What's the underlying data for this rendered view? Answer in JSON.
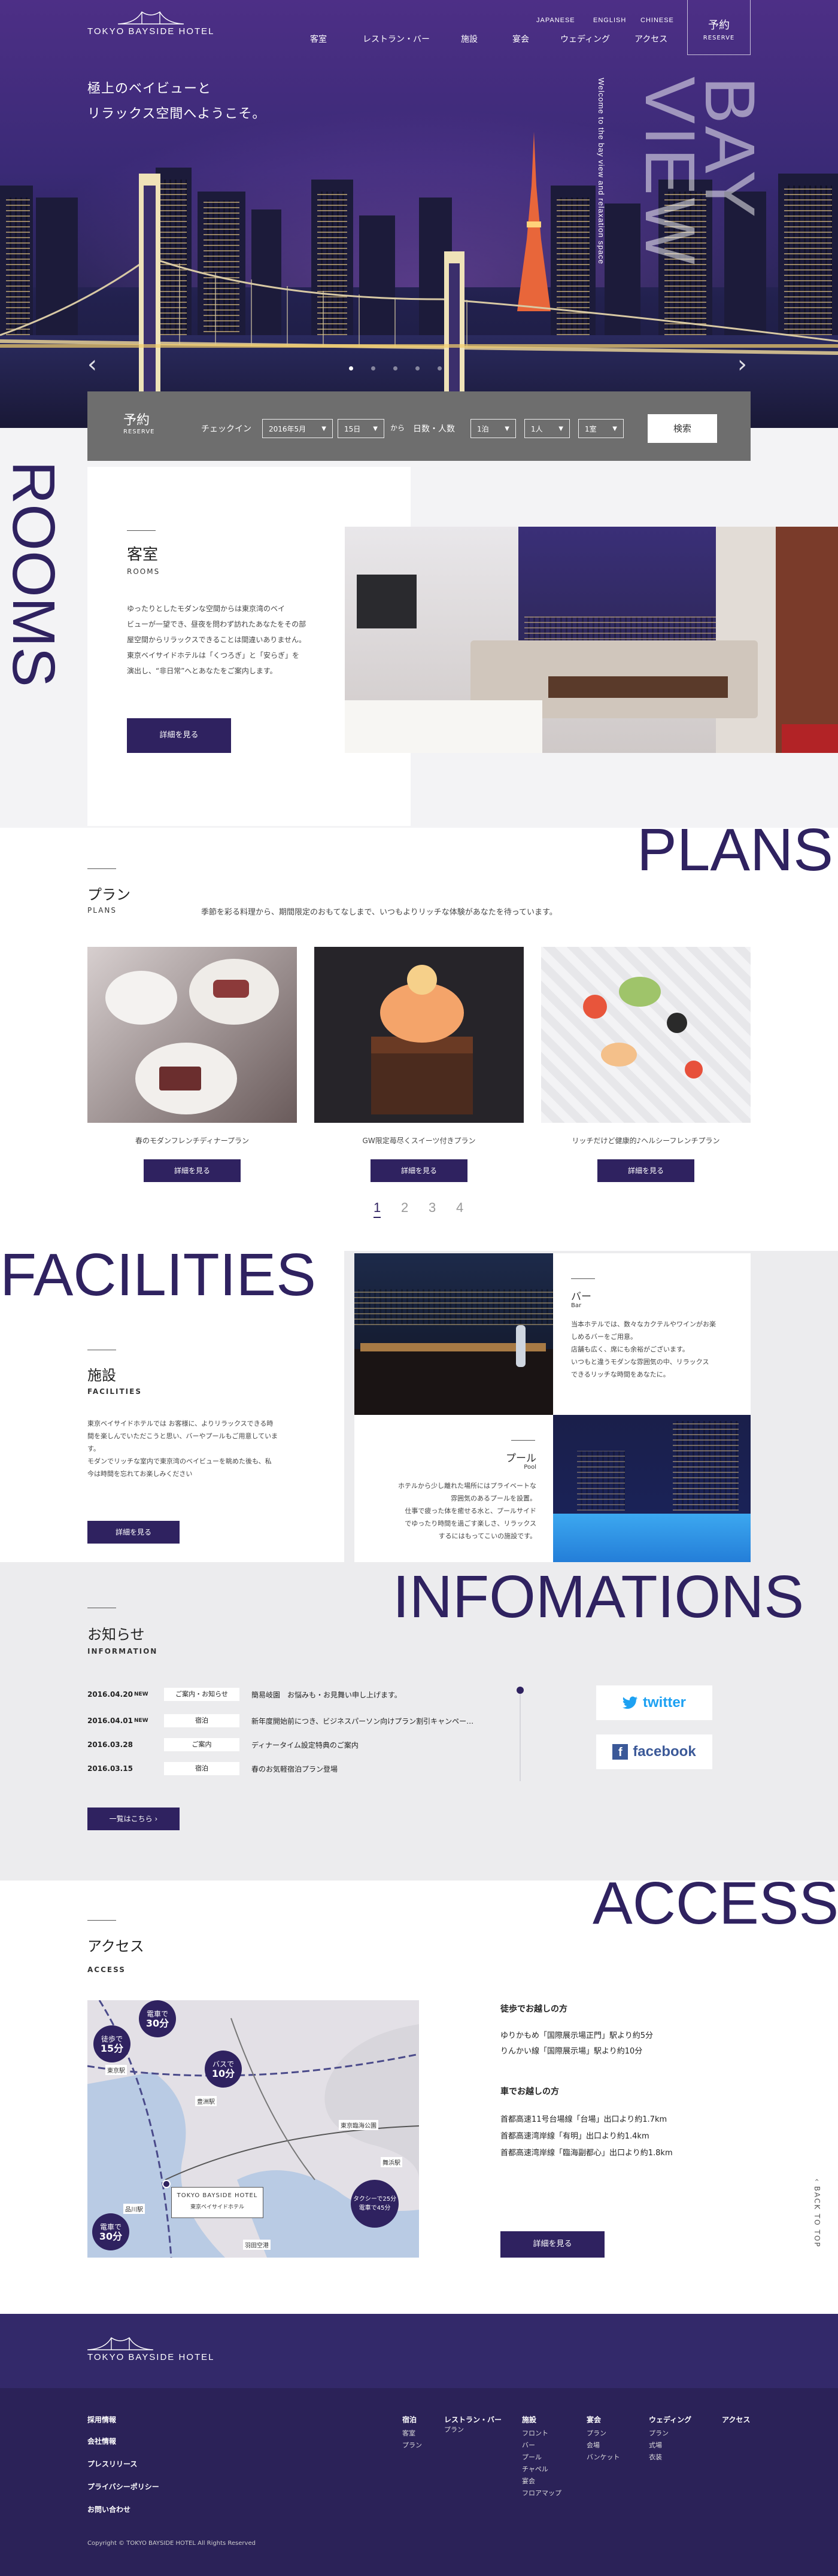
{
  "header": {
    "logo": "TOKYO BAYSIDE HOTEL",
    "langs": [
      "JAPANESE",
      "ENGLISH",
      "CHINESE"
    ],
    "nav": [
      "客室",
      "レストラン・バー",
      "施設",
      "宴会",
      "ウェディング",
      "アクセス"
    ],
    "reserve_ja": "予約",
    "reserve_en": "RESERVE"
  },
  "hero": {
    "copy_line1": "極上のベイビューと",
    "copy_line2": "リラックス空間へようこそ。",
    "big_word1": "BAY",
    "big_word2": "VIEW",
    "welcome_line1": "Welcome to",
    "welcome_line2": "the bay view and",
    "welcome_line3": "relaxation space"
  },
  "reserve_bar": {
    "title_ja": "予約",
    "title_en": "RESERVE",
    "checkin_label": "チェックイン",
    "month_value": "2016年5月",
    "day_value": "15日",
    "from_label": "から",
    "guests_label": "日数・人数",
    "nights_value": "1泊",
    "people_value": "1人",
    "rooms_value": "1室",
    "search_label": "検索"
  },
  "rooms": {
    "big": "ROOMS",
    "title_ja": "客室",
    "title_en": "ROOMS",
    "body1": "ゆったりとしたモダンな空間からは東京湾のベイ",
    "body2": "ビューが一望でき、昼夜を問わず訪れたあなたをその部",
    "body3": "屋空間からリラックスできることは間違いありません。",
    "body4": "東京ベイサイドホテルは「くつろぎ」と「安らぎ」を",
    "body5": "演出し、“非日常”へとあなたをご案内します。",
    "button": "詳細を見る"
  },
  "plans": {
    "big": "PLANS",
    "title_ja": "プラン",
    "title_en": "PLANS",
    "lead": "季節を彩る料理から、期間限定のおもてなしまで、いつもよりリッチな体験があなたを待っています。",
    "items": [
      {
        "caption": "春のモダンフレンチディナープラン",
        "button": "詳細を見る"
      },
      {
        "caption": "GW限定苺尽くスイーツ付きプラン",
        "button": "詳細を見る"
      },
      {
        "caption": "リッチだけど健康的♪ヘルシーフレンチプラン",
        "button": "詳細を見る"
      }
    ],
    "pages": [
      "1",
      "2",
      "3",
      "4"
    ]
  },
  "facilities": {
    "big": "FACILITIES",
    "title_ja": "施設",
    "title_en": "FACILITIES",
    "body1": "東京ベイサイドホテルでは お客様に、よりリラックスできる時",
    "body2": "間を楽しんでいただこうと思い、バーやプールもご用意していま",
    "body3": "す。",
    "body4": "モダンでリッチな室内で東京湾のベイビューを眺めた後も、私",
    "body5": "今は時間を忘れてお楽しみください",
    "button": "詳細を見る",
    "bar_ja": "バー",
    "bar_en": "Bar",
    "bar_body1": "当本ホテルでは、数々なカクテルやワインがお楽",
    "bar_body2": "しめるバーをご用意。",
    "bar_body3": "店舗も広く、席にも余裕がございます。",
    "bar_body4": "いつもと違うモダンな雰囲気の中、リラックス",
    "bar_body5": "できるリッチな時間をあなたに。",
    "pool_ja": "プール",
    "pool_en": "Pool",
    "pool_body1": "ホテルから少し離れた場所にはプライベートな",
    "pool_body2": "雰囲気のあるプールを設置。",
    "pool_body3": "仕事で疲った体を癒せる水と、プールサイド",
    "pool_body4": "でゆったり時間を過ごす楽しさ、リラックス",
    "pool_body5": "するにはもってこいの施設です。"
  },
  "info": {
    "big": "INFOMATIONS",
    "title_ja": "お知らせ",
    "title_en": "INFORMATION",
    "news": [
      {
        "date": "2016.04.20",
        "new": "NEW",
        "cat": "ご案内・お知らせ",
        "text": "簡易岐園　お悩みも・お見舞い申し上げます。"
      },
      {
        "date": "2016.04.01",
        "new": "NEW",
        "cat": "宿泊",
        "text": "新年度開始前につき、ビジネスパーソン向けプラン割引キャンペー…"
      },
      {
        "date": "2016.03.28",
        "new": "",
        "cat": "ご案内",
        "text": "ディナータイム設定特典のご案内"
      },
      {
        "date": "2016.03.15",
        "new": "",
        "cat": "宿泊",
        "text": "春のお気軽宿泊プラン登場"
      }
    ],
    "list_button": "一覧はこちら",
    "twitter": "twitter",
    "facebook": "facebook"
  },
  "access": {
    "big": "ACCESS",
    "title_ja": "アクセス",
    "title_en": "ACCESS",
    "walk_title": "徒歩でお越しの方",
    "walk1": "ゆりかもめ「国際展示場正門」駅より約5分",
    "walk2": "りんかい線「国際展示場」駅より約10分",
    "car_title": "車でお越しの方",
    "car1": "首都高速11号台場線「台場」出口より約1.7km",
    "car2": "首都高速湾岸線「有明」出口より約1.4km",
    "car3": "首都高速湾岸線「臨海副都心」出口より約1.8km",
    "button": "詳細を見る",
    "back_to_top": "BACK TO TOP",
    "map_badges": [
      {
        "l1": "電車で",
        "l2": "30分"
      },
      {
        "l1": "徒歩で",
        "l2": "15分"
      },
      {
        "l1": "バスで",
        "l2": "10分"
      },
      {
        "l1": "電車で",
        "l2": "30分"
      },
      {
        "l1": "タクシーで25分",
        "l2": "電車で45分"
      }
    ],
    "map_places": [
      "東京駅",
      "豊洲駅",
      "品川駅",
      "東京臨海公園",
      "舞浜駅",
      "羽田空港"
    ],
    "map_hotel": "TOKYO BAYSIDE HOTEL",
    "map_hotel_sub": "東京ベイサイドホテル"
  },
  "footer": {
    "logo": "TOKYO BAYSIDE HOTEL",
    "left": [
      "採用情報",
      "会社情報",
      "プレスリリース",
      "プライバシーポリシー",
      "お問い合わせ"
    ],
    "cols": [
      {
        "head": "宿泊",
        "subs": [
          "客室",
          "プラン"
        ]
      },
      {
        "head": "レストラン・バー",
        "subs": [
          "プラン"
        ]
      },
      {
        "head": "施設",
        "subs": [
          "フロント",
          "バー",
          "プール",
          "チャペル",
          "宴会",
          "フロアマップ"
        ]
      },
      {
        "head": "宴会",
        "subs": [
          "プラン",
          "会場",
          "バンケット"
        ]
      },
      {
        "head": "ウェディング",
        "subs": [
          "プラン",
          "式場",
          "衣装"
        ]
      },
      {
        "head": "アクセス",
        "subs": []
      }
    ],
    "copyright": "Copyright © TOKYO BAYSIDE HOTEL All Rights Reserved"
  },
  "colors": {
    "brand": "#2f2260",
    "hero_top": "#4d2f86",
    "footer": "#2b2258"
  }
}
